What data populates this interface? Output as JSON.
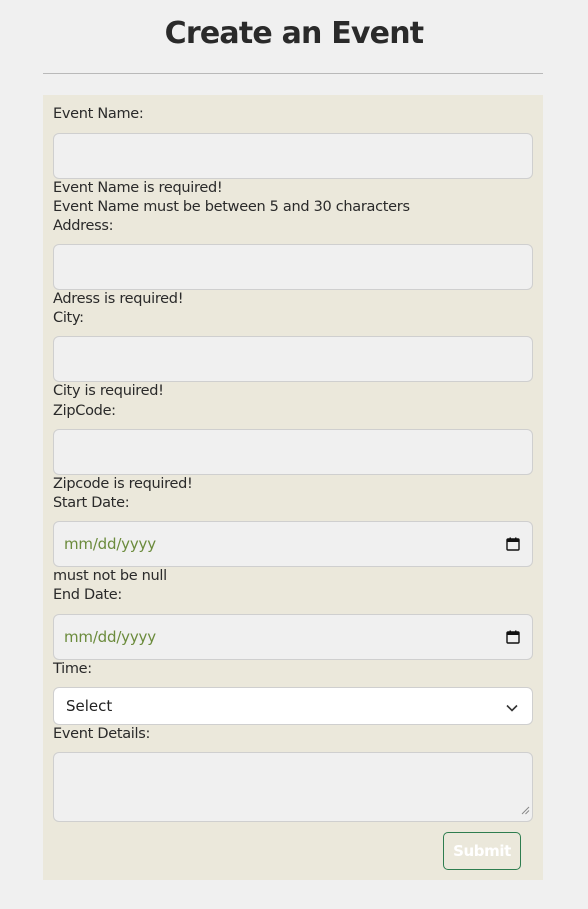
{
  "page": {
    "title": "Create an Event"
  },
  "form": {
    "event_name": {
      "label": "Event Name:",
      "value": "",
      "errors": [
        "Event Name is required!",
        "Event Name must be between 5 and 30 characters"
      ]
    },
    "address": {
      "label": "Address:",
      "value": "",
      "error": "Adress is required!"
    },
    "city": {
      "label": "City:",
      "value": "",
      "error": "City is required!"
    },
    "zipcode": {
      "label": "ZipCode:",
      "value": "",
      "error": "Zipcode is required!"
    },
    "start_date": {
      "label": "Start Date:",
      "placeholder": "mm/dd/yyyy",
      "error": "must not be null"
    },
    "end_date": {
      "label": "End Date:",
      "placeholder": "mm/dd/yyyy"
    },
    "time": {
      "label": "Time:",
      "selected": "Select"
    },
    "details": {
      "label": "Event Details:",
      "value": ""
    },
    "submit_label": "Submit"
  },
  "colors": {
    "background": "#f0f0f0",
    "card": "#ebe8db",
    "date_placeholder": "#6b8b3c",
    "submit_border": "#2e7d4f"
  },
  "icons": {
    "date": "calendar-icon",
    "select": "chevron-down-icon",
    "textarea": "resize-grip-icon"
  }
}
